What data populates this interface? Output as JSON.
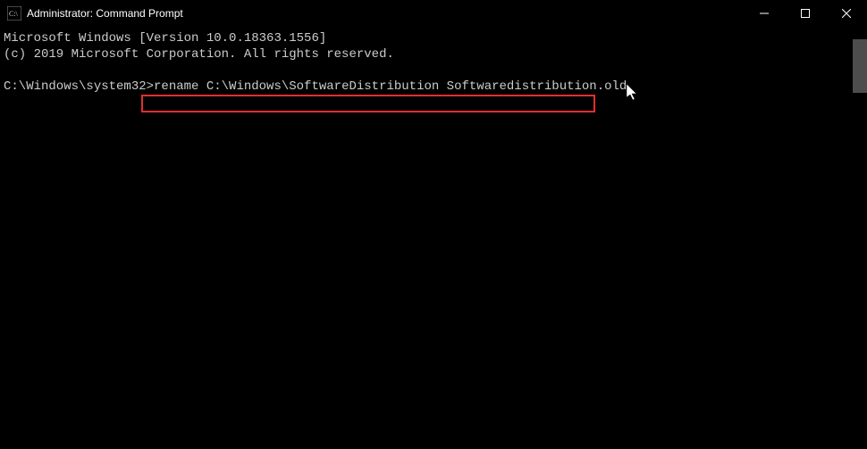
{
  "window": {
    "title": "Administrator: Command Prompt"
  },
  "terminal": {
    "line1": "Microsoft Windows [Version 10.0.18363.1556]",
    "line2": "(c) 2019 Microsoft Corporation. All rights reserved.",
    "prompt": "C:\\Windows\\system32>",
    "command": "rename C:\\Windows\\SoftwareDistribution Softwaredistribution.old"
  }
}
